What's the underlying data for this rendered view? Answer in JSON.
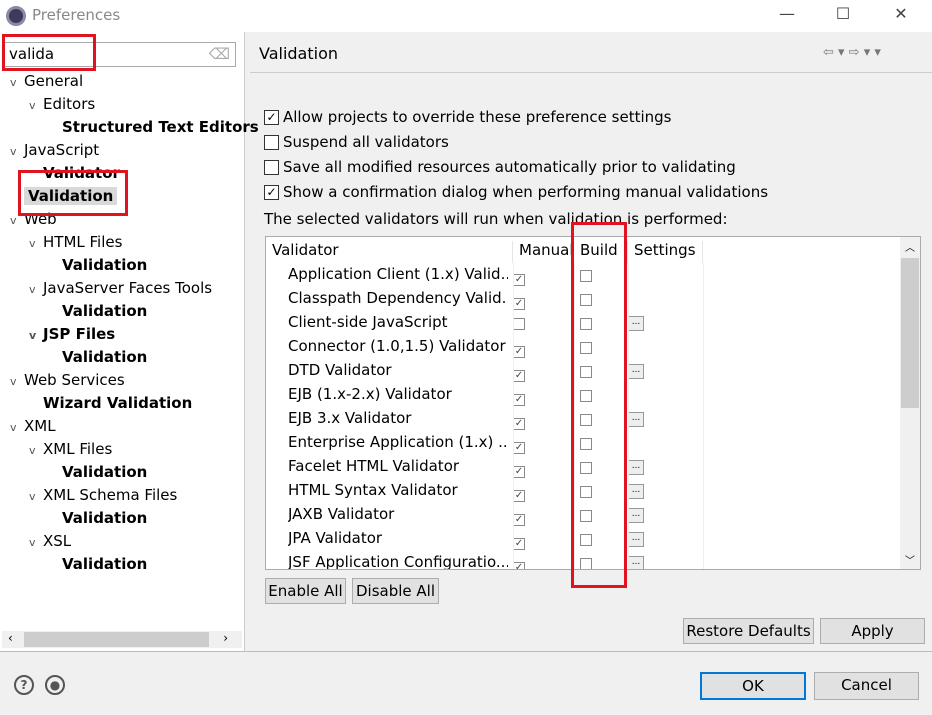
{
  "window": {
    "title": "Preferences",
    "minimize": "—",
    "maximize": "☐",
    "close": "✕"
  },
  "filter": {
    "value": "valida"
  },
  "tree": [
    {
      "label": "General",
      "level": 0,
      "bold": false,
      "expanded": true
    },
    {
      "label": "Editors",
      "level": 1,
      "bold": false,
      "expanded": true
    },
    {
      "label": "Structured Text Editors",
      "level": 2,
      "bold": true
    },
    {
      "label": "JavaScript",
      "level": 0,
      "bold": false,
      "expanded": true
    },
    {
      "label": "Validator",
      "level": 1,
      "bold": true
    },
    {
      "label": "Validation",
      "level": 0,
      "bold": true,
      "selected": true
    },
    {
      "label": "Web",
      "level": 0,
      "bold": false,
      "expanded": true
    },
    {
      "label": "HTML Files",
      "level": 1,
      "bold": false,
      "expanded": true
    },
    {
      "label": "Validation",
      "level": 2,
      "bold": true
    },
    {
      "label": "JavaServer Faces Tools",
      "level": 1,
      "bold": false,
      "expanded": true
    },
    {
      "label": "Validation",
      "level": 2,
      "bold": true
    },
    {
      "label": "JSP Files",
      "level": 1,
      "bold": true,
      "expanded": true
    },
    {
      "label": "Validation",
      "level": 2,
      "bold": true
    },
    {
      "label": "Web Services",
      "level": 0,
      "bold": false,
      "expanded": true
    },
    {
      "label": "Wizard Validation",
      "level": 1,
      "bold": true
    },
    {
      "label": "XML",
      "level": 0,
      "bold": false,
      "expanded": true
    },
    {
      "label": "XML Files",
      "level": 1,
      "bold": false,
      "expanded": true
    },
    {
      "label": "Validation",
      "level": 2,
      "bold": true
    },
    {
      "label": "XML Schema Files",
      "level": 1,
      "bold": false,
      "expanded": true
    },
    {
      "label": "Validation",
      "level": 2,
      "bold": true
    },
    {
      "label": "XSL",
      "level": 1,
      "bold": false,
      "expanded": true
    },
    {
      "label": "Validation",
      "level": 2,
      "bold": true
    }
  ],
  "page": {
    "title": "Validation",
    "nav": "⇦ ▾ ⇨ ▾ ▾"
  },
  "options": [
    {
      "label": "Allow projects to override these preference settings",
      "checked": true
    },
    {
      "label": "Suspend all validators",
      "checked": false
    },
    {
      "label": "Save all modified resources automatically prior to validating",
      "checked": false
    },
    {
      "label": "Show a confirmation dialog when performing manual validations",
      "checked": true
    }
  ],
  "info": "The selected validators will run when validation is performed:",
  "table": {
    "headers": [
      "Validator",
      "Manual",
      "Build",
      "Settings"
    ],
    "rows": [
      {
        "name": "Application Client (1.x) Valid...",
        "manual": true,
        "build": false,
        "settings": false
      },
      {
        "name": "Classpath Dependency Valid...",
        "manual": true,
        "build": false,
        "settings": false
      },
      {
        "name": "Client-side JavaScript",
        "manual": false,
        "build": false,
        "settings": true
      },
      {
        "name": "Connector (1.0,1.5) Validator",
        "manual": true,
        "build": false,
        "settings": false
      },
      {
        "name": "DTD Validator",
        "manual": true,
        "build": false,
        "settings": true
      },
      {
        "name": "EJB (1.x-2.x) Validator",
        "manual": true,
        "build": false,
        "settings": false
      },
      {
        "name": "EJB 3.x Validator",
        "manual": true,
        "build": false,
        "settings": true
      },
      {
        "name": "Enterprise Application (1.x) ...",
        "manual": true,
        "build": false,
        "settings": false
      },
      {
        "name": "Facelet HTML Validator",
        "manual": true,
        "build": false,
        "settings": true
      },
      {
        "name": "HTML Syntax Validator",
        "manual": true,
        "build": false,
        "settings": true
      },
      {
        "name": "JAXB Validator",
        "manual": true,
        "build": false,
        "settings": true
      },
      {
        "name": "JPA Validator",
        "manual": true,
        "build": false,
        "settings": true
      },
      {
        "name": "JSF Application Configuratio...",
        "manual": true,
        "build": false,
        "settings": true
      }
    ],
    "settings_label": "..."
  },
  "buttons": {
    "enable_all": "Enable All",
    "disable_all": "Disable All",
    "restore_defaults": "Restore Defaults",
    "apply": "Apply",
    "ok": "OK",
    "cancel": "Cancel"
  },
  "colors": {
    "annotation": "#e0141e",
    "selection": "#d9d9d9",
    "default_button": "#0078d7"
  }
}
